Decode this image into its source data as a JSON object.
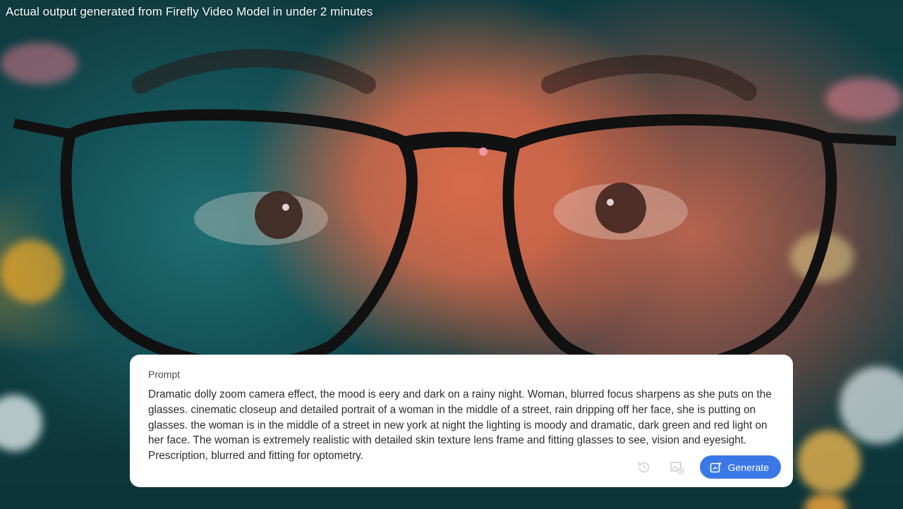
{
  "video": {
    "caption": "Actual output generated from Firefly Video Model in under 2 minutes"
  },
  "prompt_panel": {
    "label": "Prompt",
    "text": "Dramatic dolly zoom camera effect, the mood is eery and dark on a rainy night. Woman, blurred focus sharpens as she puts on the glasses. cinematic closeup and detailed portrait of a woman in the middle of a street, rain dripping off her face, she is putting on glasses. the woman is in the middle of a street in new york at night the lighting is moody and dramatic, dark green and red light on her face. The woman is extremely realistic with detailed skin texture lens frame and fitting glasses to see, vision and eyesight. Prescription, blurred and fitting for optometry.",
    "generate_label": "Generate",
    "icons": {
      "history": "history-icon",
      "image_reference": "image-reference-icon",
      "generate": "sparkle-generate-icon"
    }
  },
  "colors": {
    "accent": "#3b78e7",
    "card_background": "#ffffff",
    "text_primary": "#2c2c2c"
  }
}
